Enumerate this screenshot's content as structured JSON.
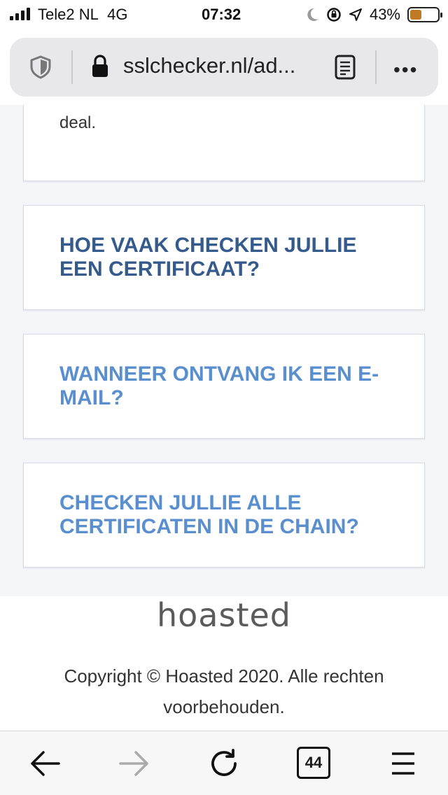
{
  "status_bar": {
    "carrier": "Tele2 NL",
    "network": "4G",
    "time": "07:32",
    "battery_percent": "43%",
    "battery_level": 0.43,
    "icons": [
      "signal-icon",
      "moon-icon",
      "orientation-lock-icon",
      "location-icon",
      "battery-icon"
    ]
  },
  "browser": {
    "url": "sslchecker.nl/ad...",
    "icons": [
      "shield-icon",
      "lock-icon",
      "reader-mode-icon",
      "more-menu-icon"
    ],
    "more_label": "•••"
  },
  "content": {
    "partial_card_text": "deal.",
    "faqs": [
      {
        "question": "HOE VAAK CHECKEN JULLIE EEN CERTIFICAAT?",
        "color": "#355a8c"
      },
      {
        "question": "WANNEER ONTVANG IK EEN E-MAIL?",
        "color": "#5a8fcf"
      },
      {
        "question": "CHECKEN JULLIE ALLE CERTIFICATEN IN DE CHAIN?",
        "color": "#5a8fcf"
      }
    ]
  },
  "footer": {
    "logo": "hoasted",
    "copyright": "Copyright © Hoasted 2020. Alle rechten voorbehouden."
  },
  "toolbar": {
    "tab_count": "44",
    "icons": [
      "back-arrow-icon",
      "forward-arrow-icon",
      "reload-icon",
      "tabs-icon",
      "hamburger-menu-icon"
    ]
  },
  "colors": {
    "accent_dark": "#355a8c",
    "accent_light": "#5a8fcf",
    "battery": "#c07a23",
    "background": "#f3f5f9"
  }
}
